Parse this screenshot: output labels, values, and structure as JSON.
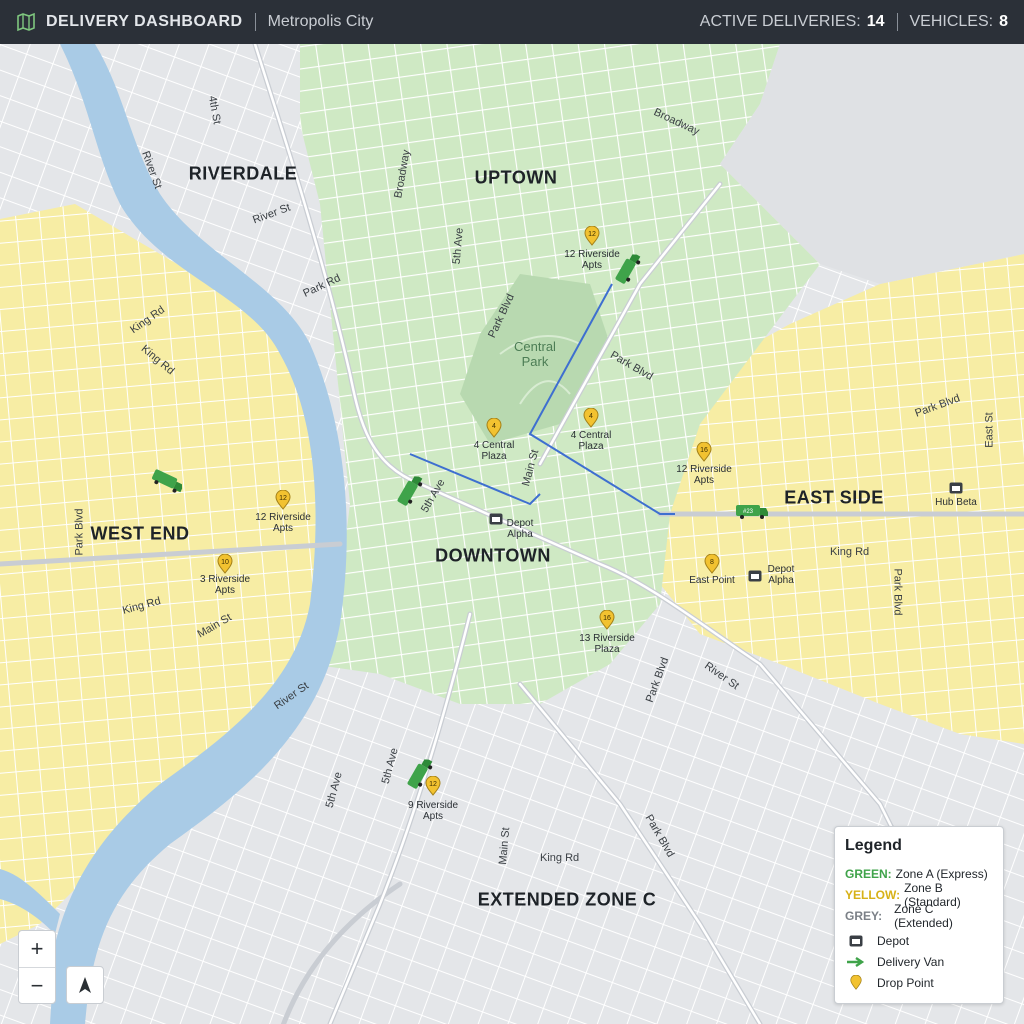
{
  "header": {
    "title": "DELIVERY DASHBOARD",
    "city": "Metropolis City",
    "active_label": "ACTIVE DELIVERIES:",
    "active_value": "14",
    "vehicles_label": "VEHICLES:",
    "vehicles_value": "8"
  },
  "colors": {
    "header_bg": "#2b3038",
    "zone_a": "#cfe9c4",
    "zone_b": "#f7eda4",
    "zone_c": "#e4e6e9",
    "river": "#a9cbe6",
    "route": "#3e6fd0",
    "van": "#3fa34a",
    "pin": "#f2c230"
  },
  "districts": {
    "riverdale": "RIVERDALE",
    "uptown": "UPTOWN",
    "west_end": "WEST END",
    "downtown": "DOWNTOWN",
    "east_side": "EAST SIDE",
    "extended": "EXTENDED ZONE C"
  },
  "park": "Central\nPark",
  "streets": {
    "s1": "4th St",
    "s2": "River St",
    "s3": "River St",
    "s4": "Park Rd",
    "s5": "King Rd",
    "s6": "King Rd",
    "s7": "Broadway",
    "s8": "Broadway",
    "s9": "5th Ave",
    "s10": "Park Blvd",
    "s11": "Park Blvd",
    "s12": "Main St",
    "s13": "5th Ave",
    "s14": "King Rd",
    "s15": "King Rd",
    "s16": "Main St",
    "s17": "River St",
    "s18": "Park Blvd",
    "s19": "River St",
    "s20": "Park Blvd",
    "s21": "King Rd",
    "s22": "Main St",
    "s23": "5th Ave",
    "s24": "5th Ave",
    "s25": "Park Blvd",
    "s26": "East St",
    "s27": "Park Blvd",
    "s28": "Park Blvd"
  },
  "pois": {
    "p1": "12 Riverside\nApts",
    "p2": "4 Central\nPlaza",
    "p3": "4 Central\nPlaza",
    "p4": "12 Riverside\nApts",
    "p5": "12 Riverside\nApts",
    "p6": "3 Riverside\nApts",
    "p7": "East Point",
    "p8": "13 Riverside\nPlaza",
    "p9": "9 Riverside\nApts",
    "depot_alpha": "Depot\nAlpha",
    "depot_alpha_2": "Depot\nAlpha",
    "hub_beta": "Hub Beta"
  },
  "pin_numbers": {
    "n1": "12",
    "n2": "4",
    "n3": "4",
    "n4": "16",
    "n5": "12",
    "n6": "10",
    "n7": "8",
    "n8": "16",
    "n9": "12"
  },
  "van_ids": {
    "v1": "#23"
  },
  "legend": {
    "title": "Legend",
    "green_key": "GREEN:",
    "green_val": "Zone A (Express)",
    "yellow_key": "YELLOW:",
    "yellow_val": "Zone B (Standard)",
    "grey_key": "GREY:",
    "grey_val": "Zone C (Extended)",
    "depot": "Depot",
    "van": "Delivery Van",
    "drop": "Drop Point"
  },
  "controls": {
    "zoom_in": "+",
    "zoom_out": "−"
  }
}
